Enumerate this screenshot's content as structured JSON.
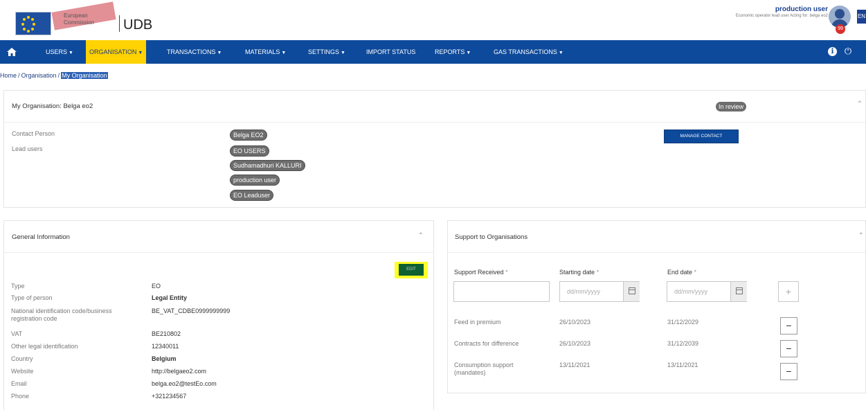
{
  "header": {
    "logo_line1": "European",
    "logo_line2": "Commission",
    "app_name": "UDB",
    "user_name": "production user",
    "user_role": "Economic operator lead user Acting for: belga eo2",
    "notification_count": "99",
    "lang": "EN"
  },
  "nav": {
    "items": [
      "USERS",
      "ORGANISATION",
      "TRANSACTIONS",
      "MATERIALS",
      "SETTINGS",
      "IMPORT STATUS",
      "REPORTS",
      "GAS TRANSACTIONS"
    ]
  },
  "breadcrumb": {
    "home": "Home",
    "organisation": "Organisation",
    "current": "My Organisation"
  },
  "org_card": {
    "title": "My Organisation: Belga eo2",
    "status": "In review",
    "contact_label": "Contact Person",
    "lead_users_label": "Lead users",
    "contact_person": "Belga EO2",
    "lead_users": [
      "EO USERS",
      "Sudhamadhuri KALLURI",
      "production user",
      "EO Leaduser"
    ],
    "manage_contact": "MANAGE CONTACT"
  },
  "general_info": {
    "title": "General Information",
    "edit": "EDIT",
    "rows": [
      {
        "label": "Type",
        "value": "EO"
      },
      {
        "label": "Type of person",
        "value": "Legal Entity"
      },
      {
        "label": "National identification code/business registration code",
        "value": "BE_VAT_CDBE0999999999"
      },
      {
        "label": "VAT",
        "value": "BE210802"
      },
      {
        "label": "Other legal identification",
        "value": "12340011"
      },
      {
        "label": "Country",
        "value": "Belgium"
      },
      {
        "label": "Website",
        "value": "http://belgaeo2.com"
      },
      {
        "label": "Email",
        "value": "belga.eo2@testEo.com"
      },
      {
        "label": "Phone",
        "value": "+321234567"
      }
    ]
  },
  "support": {
    "title": "Support to Organisations",
    "col_support": "Support Received",
    "col_start": "Starting date",
    "col_end": "End date",
    "req": "*",
    "date_placeholder": "dd/mm/yyyy",
    "rows": [
      {
        "type": "Feed in premium",
        "start": "26/10/2023",
        "end": "31/12/2029"
      },
      {
        "type": "Contracts for difference",
        "start": "26/10/2023",
        "end": "31/12/2039"
      },
      {
        "type": "Consumption support (mandates)",
        "start": "13/11/2021",
        "end": "13/11/2021"
      }
    ]
  }
}
